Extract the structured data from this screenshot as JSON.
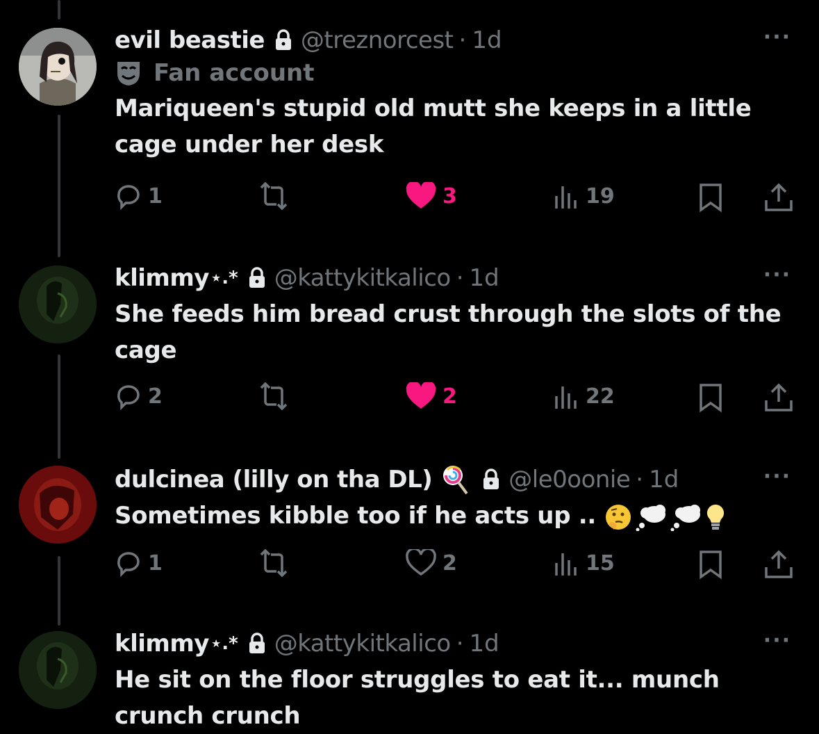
{
  "tweets": [
    {
      "name": "evil beastie",
      "name_deco": "",
      "handle": "@treznorcest",
      "separator": "·",
      "time": "1d",
      "badge": "Fan account",
      "body_lines": [
        "Mariqueen's stupid old mutt she keeps in a little",
        "cage under her desk"
      ],
      "replies": "1",
      "likes": "3",
      "liked": true,
      "views": "19",
      "more": "···"
    },
    {
      "name": "klimmy",
      "name_deco": "⋆.*",
      "handle": "@kattykitkalico",
      "separator": "·",
      "time": "1d",
      "body_lines": [
        "She feeds him bread crust through the slots of the",
        "cage"
      ],
      "replies": "2",
      "likes": "2",
      "liked": true,
      "views": "22",
      "more": "···"
    },
    {
      "name": "dulcinea (lilly on tha DL)",
      "name_deco": "",
      "name_emoji": "lollipop-icon",
      "handle": "@le0oonie",
      "separator": "·",
      "time": "1d",
      "body_lines": [
        "Sometimes kibble too if he acts up .."
      ],
      "body_emojis": [
        "thinking-face-icon",
        "thought-balloon-icon",
        "thought-balloon-icon",
        "light-bulb-icon"
      ],
      "replies": "1",
      "likes": "2",
      "liked": false,
      "views": "15",
      "more": "···"
    },
    {
      "name": "klimmy",
      "name_deco": "⋆.*",
      "handle": "@kattykitkalico",
      "separator": "·",
      "time": "1d",
      "body_lines": [
        "He sit on the floor struggles to eat it... munch",
        "crunch crunch"
      ],
      "more": "···"
    }
  ],
  "colors": {
    "background": "#000000",
    "text": "#e7e9ea",
    "secondary": "#71767b",
    "like": "#f91880",
    "thread_line": "#333639"
  }
}
